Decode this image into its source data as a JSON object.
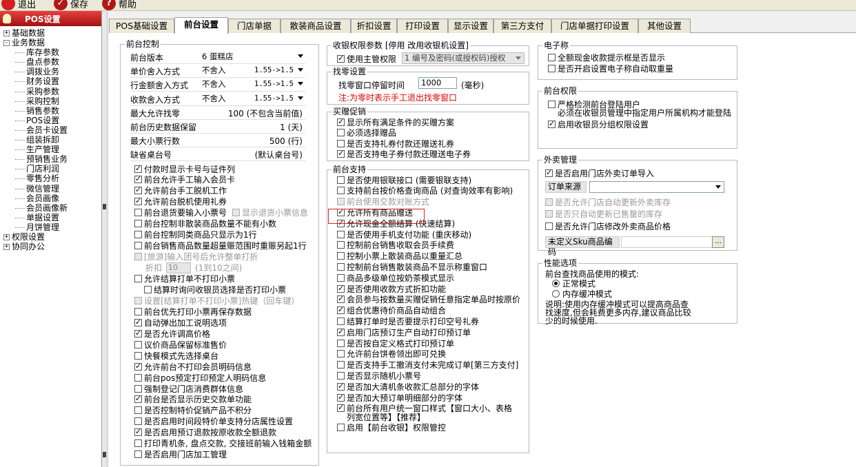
{
  "toolbar": {
    "exit": "退出",
    "save": "保存",
    "help": "帮助"
  },
  "sidebar": {
    "title": "POS设置",
    "items": [
      {
        "label": "基础数据",
        "level": 0,
        "exp": "+"
      },
      {
        "label": "业务数据",
        "level": 0,
        "exp": "-"
      },
      {
        "label": "库存参数",
        "level": 1
      },
      {
        "label": "盘点参数",
        "level": 1
      },
      {
        "label": "调拨业务",
        "level": 1
      },
      {
        "label": "财务设置",
        "level": 1
      },
      {
        "label": "采购参数",
        "level": 1
      },
      {
        "label": "采购控制",
        "level": 1
      },
      {
        "label": "销售参数",
        "level": 1
      },
      {
        "label": "POS设置",
        "level": 1
      },
      {
        "label": "会员卡设置",
        "level": 1
      },
      {
        "label": "组装拆卸",
        "level": 1
      },
      {
        "label": "生产管理",
        "level": 1
      },
      {
        "label": "预销售业务",
        "level": 1
      },
      {
        "label": "门店利润",
        "level": 1
      },
      {
        "label": "零售分析",
        "level": 1
      },
      {
        "label": "微信管理",
        "level": 1
      },
      {
        "label": "会员画像",
        "level": 1
      },
      {
        "label": "会员画像新",
        "level": 1
      },
      {
        "label": "单据设置",
        "level": 1
      },
      {
        "label": "月饼管理",
        "level": 1
      },
      {
        "label": "权限设置",
        "level": 0,
        "exp": "+"
      },
      {
        "label": "协同办公",
        "level": 0,
        "exp": "+"
      }
    ]
  },
  "tabs": [
    "POS基础设置",
    "前台设置",
    "门店单据",
    "散装商品设置",
    "折扣设置",
    "打印设置",
    "显示设置",
    "第三方支付",
    "门店单据打印设置",
    "其他设置"
  ],
  "active_tab": "前台设置",
  "frontControl": {
    "title": "前台控制",
    "fields": [
      {
        "label": "前台版本",
        "value": "6 蛋糕店",
        "combo": true
      },
      {
        "label": "单价舍入方式",
        "value": "不舍入",
        "value2": "1.55->1.5",
        "combo": true
      },
      {
        "label": "行金额舍入方式",
        "value": "不舍入",
        "value2": "1.55->1.5",
        "combo": true
      },
      {
        "label": "收款舍入方式",
        "value": "不舍入",
        "value2": "1.55->1.5",
        "combo": true
      },
      {
        "label": "最大允许找零",
        "value": "100 (不包含当前值)"
      },
      {
        "label": "前台历史数据保留",
        "value": "1 (天)"
      },
      {
        "label": "最大小票行数",
        "value": "500 (行)"
      },
      {
        "label": "缺省桌台号",
        "value": "(默认桌台号)"
      }
    ],
    "checks": [
      {
        "label": "付款时显示卡号与证件列",
        "on": true
      },
      {
        "label": "前台允许手工输入会员卡",
        "on": true
      },
      {
        "label": "允许前台手工脱机工作",
        "on": true
      },
      {
        "label": "允许前台脱机使用礼券",
        "on": true
      },
      {
        "label": "前台退货要输入小票号",
        "on": false,
        "side": "显示退货小票信息"
      },
      {
        "label": "前台控制非散装商品数量不能有小数",
        "on": false
      },
      {
        "label": "前台控制同类商品只显示为1行",
        "on": false
      },
      {
        "label": "前台销售商品数量超量赈范围时重赈另起1行",
        "on": false
      },
      {
        "label": "[旅游]输入团号后允许整单打折",
        "on": false,
        "dis": true
      },
      {
        "label": "折扣",
        "discount": "10",
        "note": "(1到10之间)",
        "dis": true
      },
      {
        "label": "允许结算打单不打印小票",
        "on": false
      },
      {
        "label": "结算时询问收银员选择是否打印小票",
        "on": false,
        "indent": true
      },
      {
        "label": "设置[结算打单不打印小票]热键（回车键）",
        "on": false,
        "dis": true
      },
      {
        "label": "前台优先打印小票再保存数据",
        "on": false
      },
      {
        "label": "自动弹出加工说明选项",
        "on": true
      },
      {
        "label": "是否允许调高价格",
        "on": true
      },
      {
        "label": "议价商品保留标准售价",
        "on": false
      },
      {
        "label": "快餐模式先选择桌台",
        "on": false
      },
      {
        "label": "允许前台不打印会员明码信息",
        "on": true
      },
      {
        "label": "前台pos预定打印预定人明码信息",
        "on": false
      },
      {
        "label": "强制登记门店消费群体信息",
        "on": false
      },
      {
        "label": "前台是否显示历史交款单功能",
        "on": true
      },
      {
        "label": "是否控制特价促销产品不积分",
        "on": false
      },
      {
        "label": "是否启用时间段特价单支持分店属性设置",
        "on": false
      },
      {
        "label": "是否启用预订退款按原收款全额退款",
        "on": true
      },
      {
        "label": "打印青机条, 盘点交款, 交接班前输入钱箱金额",
        "on": false
      },
      {
        "label": "是否启用门店加工管理",
        "on": false
      }
    ]
  },
  "permParams": {
    "title": "收银权限参数 [停用  改用收银机设置]",
    "check": "使用主管权限",
    "on": true,
    "select": "1 编号及密码(或授权码)授权"
  },
  "change": {
    "title": "找零设置",
    "label": "找零窗口停留时间",
    "value": "1000",
    "unit": "(毫秒)",
    "note": "注:为零时表示手工退出找零窗口"
  },
  "gift": {
    "title": "买赠促销",
    "checks": [
      {
        "label": "显示所有满足条件的买赠方案",
        "on": true
      },
      {
        "label": "必须选择赠品",
        "on": false
      },
      {
        "label": "是否支持礼券付款还赠送礼券",
        "on": false
      },
      {
        "label": "是否支持电子券付款还赠送电子券",
        "on": true
      }
    ]
  },
  "support": {
    "title": "前台支持",
    "checks": [
      {
        "label": "是否使用银联接口 (需要银联支持)",
        "on": false
      },
      {
        "label": "支持前台按价格查询商品 (对查询效率有影响)",
        "on": false
      },
      {
        "label": "前台使用交款对账方式",
        "on": false,
        "dis": true
      },
      {
        "label": "允许所有商品赠送",
        "on": true,
        "hl": true
      },
      {
        "label": "允许现金全额结算 (快速结算)",
        "on": true
      },
      {
        "label": "是否使用手机支付功能 (重庆移动)",
        "on": false
      },
      {
        "label": "控制前台销售收取会员手续费",
        "on": false
      },
      {
        "label": "控制小票上散装商品以重量汇总",
        "on": false
      },
      {
        "label": "控制前台销售散装商品不显示称重窗口",
        "on": false
      },
      {
        "label": "商品多级单位按奶茶模式显示",
        "on": false
      },
      {
        "label": "是否使用收款方式折扣功能",
        "on": true
      },
      {
        "label": "会员参与按数量买赠促销任意指定单品时按原价",
        "on": true
      },
      {
        "label": "组合优惠待价商品自动组合",
        "on": true
      },
      {
        "label": "结算打单时是否要提示打印空号礼券",
        "on": false
      },
      {
        "label": "启用门店预订生产自动打印预订单",
        "on": true
      },
      {
        "label": "是否按自定义格式打印预订单",
        "on": false
      },
      {
        "label": "允许前台饼卷领出即可兑换",
        "on": false
      },
      {
        "label": "是否支持手工撤消支付未完成订单[第三方支付]",
        "on": false
      },
      {
        "label": "是否显示随机小票号",
        "on": false
      },
      {
        "label": "是否加大清机条收款汇总部分的字体",
        "on": true
      },
      {
        "label": "是否加大预订单明细部分的字体",
        "on": true
      },
      {
        "label": "前台所有用户统一窗口样式【窗口大小、表格",
        "line2": "列宽位置等】【推荐】",
        "on": true
      },
      {
        "label": "启用【前台收银】权限管控",
        "on": false
      }
    ]
  },
  "scale": {
    "title": "电子称",
    "checks": [
      {
        "label": "全额现金收款提示框是否显示",
        "on": false
      },
      {
        "label": "是否开启设置电子称自动取重量",
        "on": false
      }
    ]
  },
  "frontPerm": {
    "title": "前台权限",
    "checks": [
      {
        "label": "严格检测前台登陆用户",
        "line2": "必须在收银员管理中指定用户所属机构才能登陆",
        "on": false
      },
      {
        "label": "启用收银员分组权限设置",
        "on": true
      }
    ]
  },
  "takeout": {
    "title": "外卖管理",
    "check1": {
      "label": "是否启用门店外卖订单导入",
      "on": true
    },
    "sourceLabel": "订单来源",
    "sourceValue": "",
    "checks": [
      {
        "label": "是否允许门店自动更新外卖库存",
        "on": false,
        "dis": true
      },
      {
        "label": "是否只自动更新已售罄的库存",
        "on": false,
        "dis": true
      },
      {
        "label": "是否允许门店修改外卖商品价格",
        "on": false
      }
    ],
    "skuLabel": "未定义Sku商品编码",
    "skuValue": "",
    "skuBtn": "..."
  },
  "perf": {
    "title": "性能选项",
    "label": "前台查找商品使用的模式:",
    "radios": [
      {
        "label": "正常模式",
        "on": true
      },
      {
        "label": "内存缓冲模式",
        "on": false
      }
    ],
    "note": [
      "说明:使用内存缓冲模式可以提高商品查",
      "找速度,但会耗费更多内存,建议商品比较",
      "少的时候使用."
    ]
  }
}
